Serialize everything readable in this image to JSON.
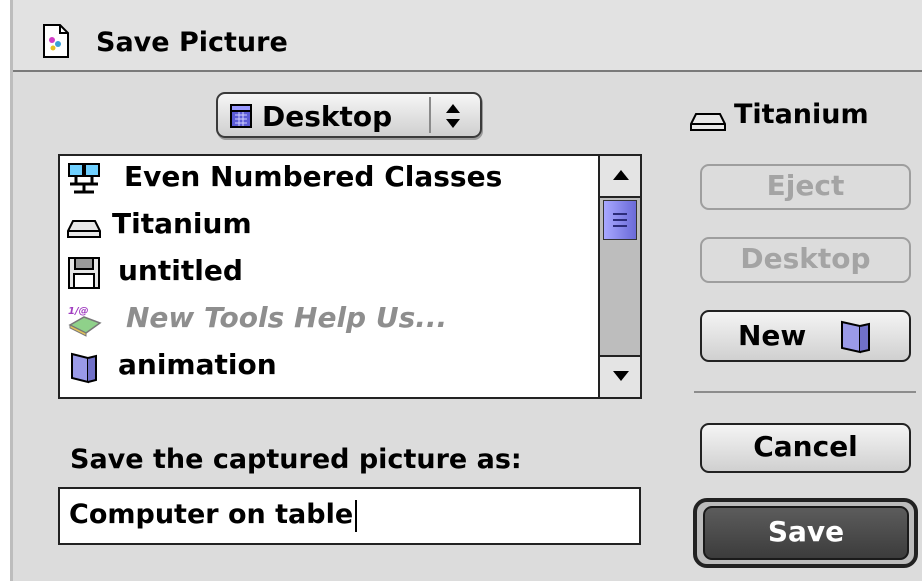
{
  "dialog": {
    "title": "Save Picture"
  },
  "location_popup": {
    "selected": "Desktop"
  },
  "volume": {
    "name": "Titanium"
  },
  "file_list": {
    "items": [
      {
        "label": "Even Numbered Classes",
        "icon": "shared-folder-icon",
        "dimmed": false
      },
      {
        "label": "Titanium",
        "icon": "hard-drive-icon",
        "dimmed": false
      },
      {
        "label": "untitled",
        "icon": "floppy-disk-icon",
        "dimmed": false
      },
      {
        "label": "New Tools Help Us...",
        "icon": "document-icon",
        "dimmed": true
      },
      {
        "label": "animation",
        "icon": "folder-icon",
        "dimmed": false
      }
    ]
  },
  "buttons": {
    "eject": "Eject",
    "desktop": "Desktop",
    "new": "New",
    "cancel": "Cancel",
    "save": "Save"
  },
  "save_prompt": "Save the captured picture as:",
  "filename": {
    "value": "Computer on table"
  },
  "colors": {
    "scroll_thumb": "#8a8aee",
    "save_button": "#4a4a4a"
  }
}
